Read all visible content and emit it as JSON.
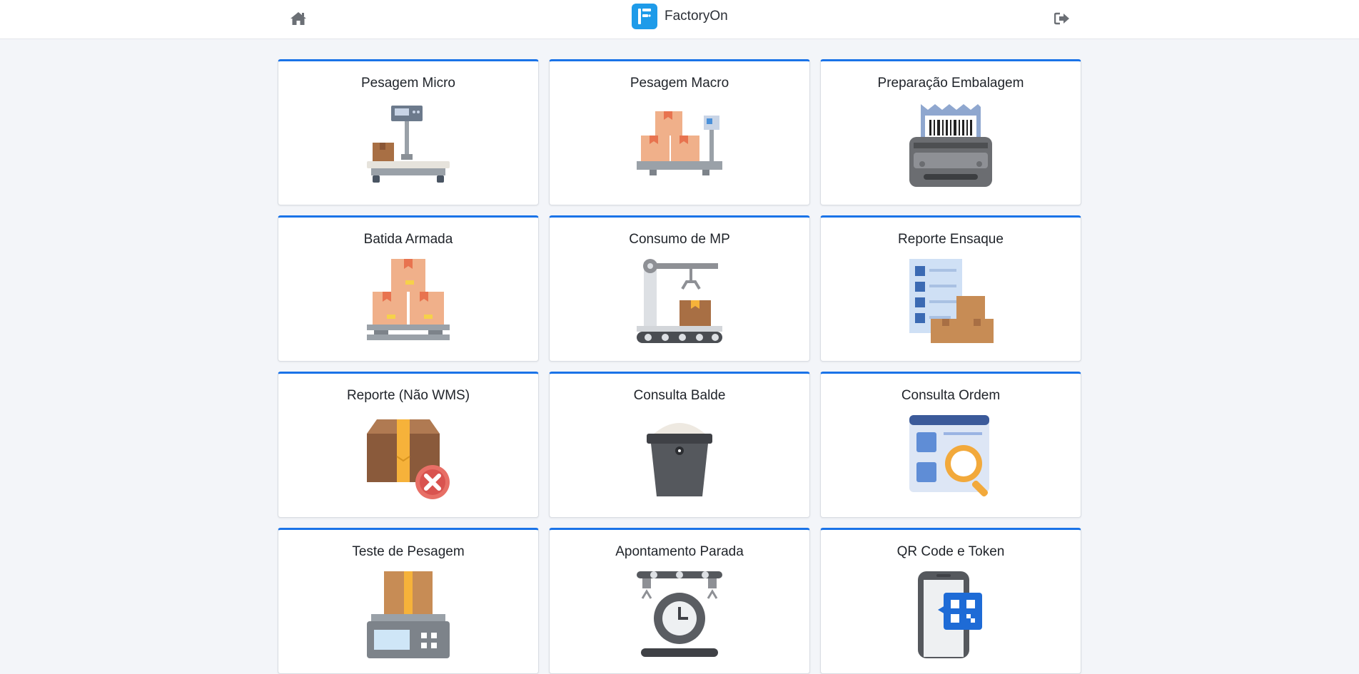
{
  "header": {
    "brand_name": "FactoryOn",
    "home_icon": "home-icon",
    "logout_icon": "logout-icon"
  },
  "colors": {
    "accent": "#1a73e8",
    "logo": "#1e9be9",
    "background": "#f3f5f9"
  },
  "cards": [
    {
      "title": "Pesagem Micro",
      "icon": "platform-scale-icon"
    },
    {
      "title": "Pesagem Macro",
      "icon": "boxes-on-scale-icon"
    },
    {
      "title": "Preparação Embalagem",
      "icon": "label-printer-icon"
    },
    {
      "title": "Batida Armada",
      "icon": "pallet-boxes-icon"
    },
    {
      "title": "Consumo de MP",
      "icon": "conveyor-crane-icon"
    },
    {
      "title": "Reporte Ensaque",
      "icon": "checklist-boxes-icon"
    },
    {
      "title": "Reporte (Não WMS)",
      "icon": "box-rejected-icon"
    },
    {
      "title": "Consulta Balde",
      "icon": "bucket-icon"
    },
    {
      "title": "Consulta Ordem",
      "icon": "order-search-icon"
    },
    {
      "title": "Teste de Pesagem",
      "icon": "weighing-test-icon"
    },
    {
      "title": "Apontamento Parada",
      "icon": "downtime-gear-clock-icon"
    },
    {
      "title": "QR Code e Token",
      "icon": "phone-qr-code-icon"
    }
  ]
}
